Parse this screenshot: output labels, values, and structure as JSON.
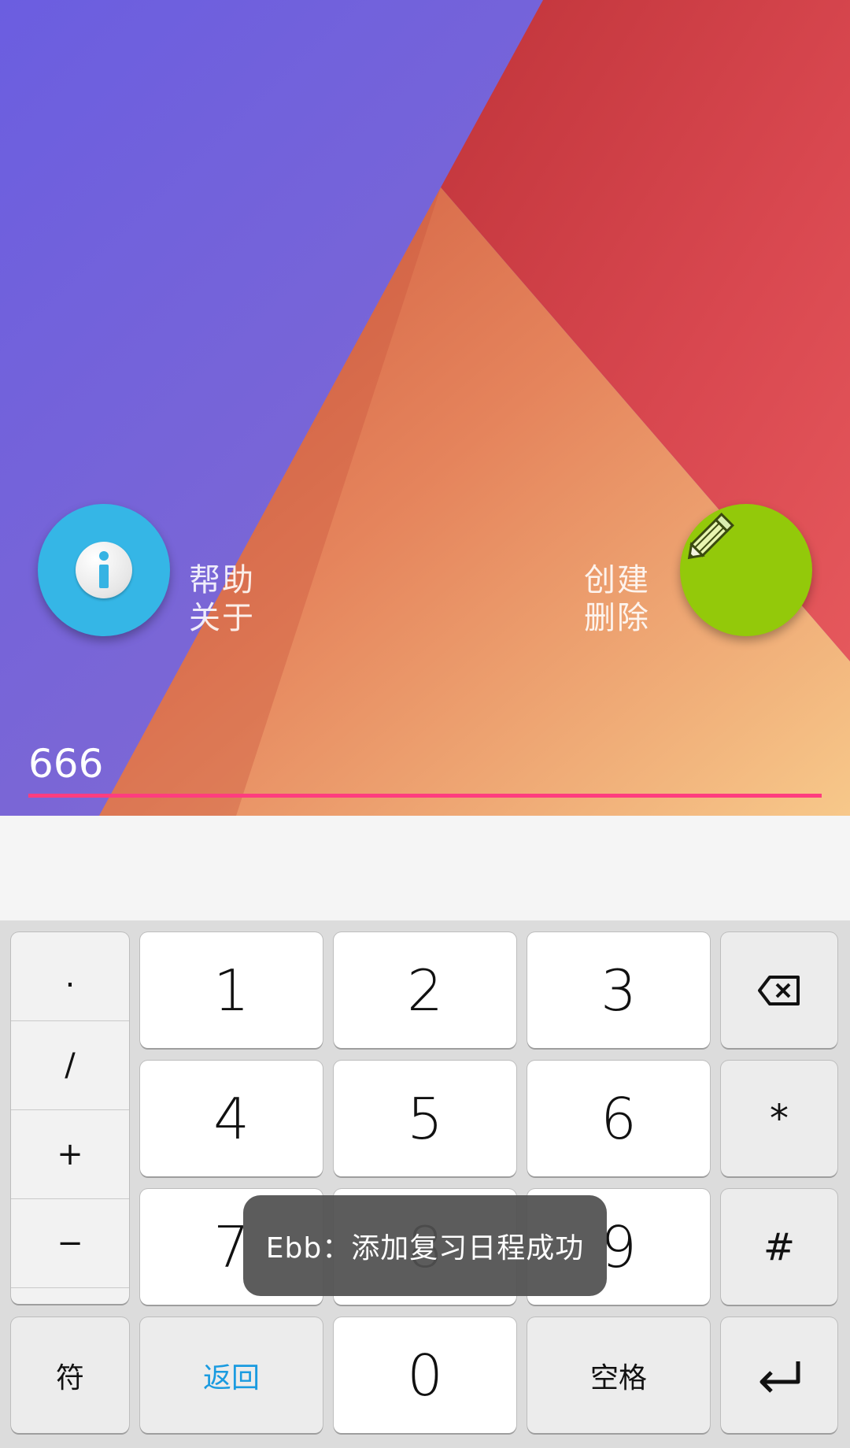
{
  "colors": {
    "info_fab": "#35b6e6",
    "edit_fab": "#93c90a",
    "input_underline": "#ff3d7f",
    "return_label": "#1a9be0",
    "toast_bg": "#505050"
  },
  "wallpaper": {
    "left_fab": {
      "icon": "info-icon",
      "label_line1": "帮助",
      "label_line2": "关于"
    },
    "right_fab": {
      "icon": "pencil-icon",
      "label_line1": "创建",
      "label_line2": "删除"
    },
    "input": {
      "value": "666"
    }
  },
  "keyboard": {
    "symbols": [
      ".",
      "/",
      "+",
      "−"
    ],
    "digits": {
      "k1": "1",
      "k2": "2",
      "k3": "3",
      "k4": "4",
      "k5": "5",
      "k6": "6",
      "k7": "7",
      "k8": "8",
      "k9": "9",
      "k0": "0"
    },
    "keys": {
      "backspace_icon": "backspace-icon",
      "star": "*",
      "hash": "#",
      "symbols_label": "符",
      "return_label": "返回",
      "space_label": "空格",
      "enter_icon": "enter-icon"
    }
  },
  "toast": {
    "message": "Ebb：添加复习日程成功"
  }
}
